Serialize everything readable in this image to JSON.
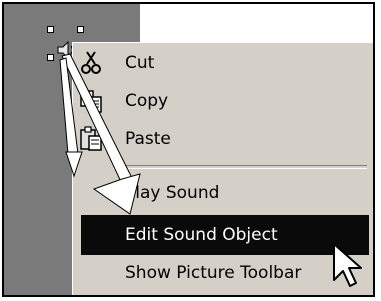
{
  "menu": {
    "items": [
      {
        "label": "Cut",
        "icon": "scissors-icon"
      },
      {
        "label": "Copy",
        "icon": "copy-icon"
      },
      {
        "label": "Paste",
        "icon": "paste-icon"
      },
      {
        "label": "Play Sound"
      },
      {
        "label": "Edit Sound Object",
        "selected": true
      },
      {
        "label": "Show Picture Toolbar"
      }
    ]
  },
  "colors": {
    "menu_bg": "#d4d0c8",
    "selection_bg": "#0a0a0a",
    "slide_bg": "#7a7a7a"
  }
}
